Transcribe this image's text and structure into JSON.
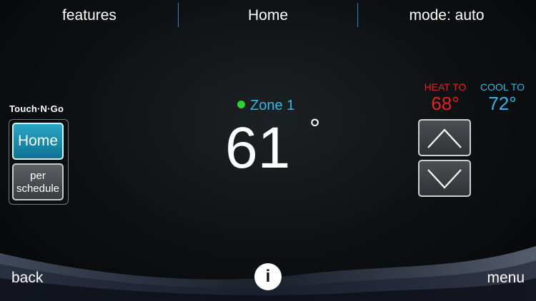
{
  "topbar": {
    "features_label": "features",
    "title": "Home",
    "mode_label": "mode: auto",
    "divider_color": "#2a7fcf"
  },
  "touch_n_go": {
    "label": "Touch·N·Go",
    "home_label": "Home",
    "schedule_label": "per schedule"
  },
  "zone": {
    "name": "Zone 1",
    "status_color": "#2fd12f",
    "temperature": "61",
    "degree_symbol": "°"
  },
  "setpoints": {
    "heat_label": "HEAT TO",
    "heat_value": "68°",
    "heat_color": "#e52222",
    "cool_label": "COOL TO",
    "cool_value": "72°",
    "cool_color": "#34b3e6"
  },
  "controls": {
    "up_icon": "chevron-up-icon",
    "down_icon": "chevron-down-icon"
  },
  "bottombar": {
    "back_label": "back",
    "info_label": "i",
    "menu_label": "menu"
  }
}
